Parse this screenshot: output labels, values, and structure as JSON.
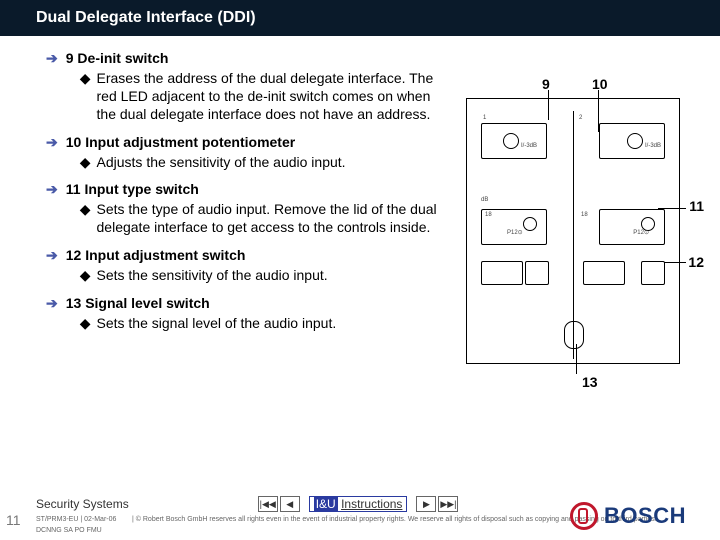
{
  "title": "Dual Delegate Interface (DDI)",
  "items": [
    {
      "num": "9",
      "name": "De-init switch",
      "sub": "Erases the address of the dual delegate interface. The red LED adjacent to the        de-init switch comes on when the dual delegate interface does not have an address."
    },
    {
      "num": "10",
      "name": "Input adjustment potentiometer",
      "sub": "Adjusts the sensitivity of the audio input."
    },
    {
      "num": "11",
      "name": "Input type switch",
      "sub": "Sets the type of audio input. Remove the lid of the dual delegate interface to get access to the controls inside."
    },
    {
      "num": "12",
      "name": "Input adjustment switch",
      "sub": "Sets the sensitivity of the audio input."
    },
    {
      "num": "13",
      "name": "Signal level switch",
      "sub": "Sets the signal level of the audio input."
    }
  ],
  "callouts": {
    "c9": "9",
    "c10": "10",
    "c11": "11",
    "c12": "12",
    "c13": "13"
  },
  "footer": {
    "left": "Security Systems",
    "iu": "I&U Instructions",
    "small1": "ST/PRM3-EU | 02-Mar-06",
    "small2": "DCNNG SA PO FMU",
    "rights": "| © Robert Bosch GmbH reserves all rights even in the event of industrial property rights. We reserve all rights of disposal such as copying and passing on to third parties.",
    "page": "11",
    "brand": "BOSCH"
  }
}
